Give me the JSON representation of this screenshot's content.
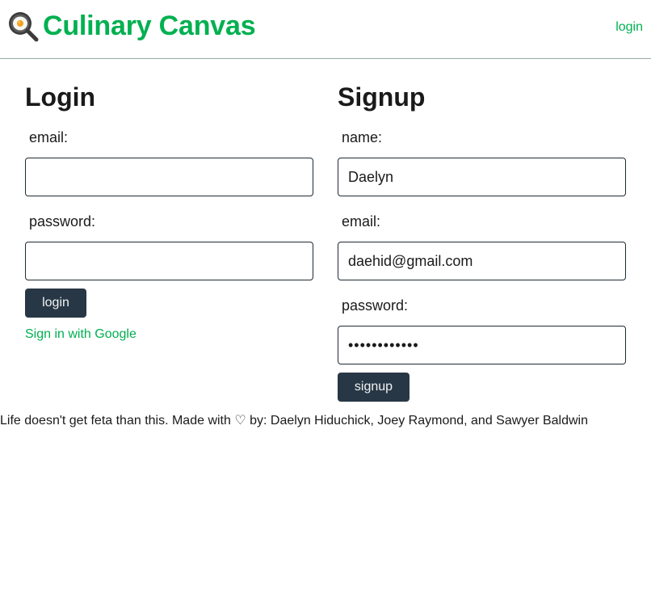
{
  "header": {
    "brand_title": "Culinary Canvas",
    "brand_icon": "frying-pan-egg-icon",
    "login_link": "login",
    "accent_color": "#00b050"
  },
  "login": {
    "heading": "Login",
    "email_label": "email:",
    "email_value": "",
    "password_label": "password:",
    "password_value": "",
    "submit_label": "login",
    "google_link": "Sign in with Google"
  },
  "signup": {
    "heading": "Signup",
    "name_label": "name:",
    "name_value": "Daelyn",
    "email_label": "email:",
    "email_value": "daehid@gmail.com",
    "password_label": "password:",
    "password_value": "••••••••••••",
    "submit_label": "signup"
  },
  "footer": {
    "text_before_heart": "Life doesn't get feta than this. Made with ",
    "heart": "♡",
    "text_after_heart": " by: Daelyn Hiduchick, Joey Raymond, and Sawyer Baldwin"
  },
  "colors": {
    "button_bg": "#283745",
    "input_border": "#1f2a33",
    "header_border": "#9aa9a6"
  }
}
